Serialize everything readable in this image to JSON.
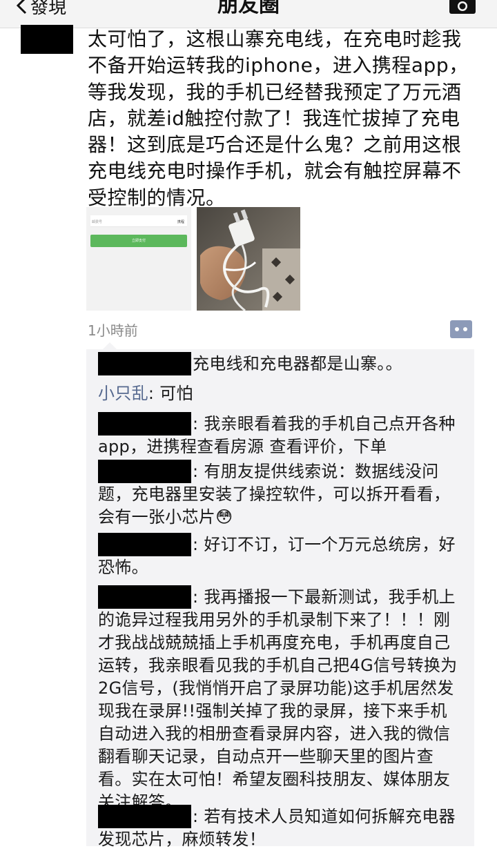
{
  "navbar": {
    "back_label": "發現",
    "title": "朋友圈",
    "back_icon": "chevron-left-icon",
    "camera_icon": "camera-icon"
  },
  "post": {
    "text": "太可怕了，这根山寨充电线，在充电时趁我不备开始运转我的iphone，进入携程app，等我发现，我的手机已经替我预定了万元酒店，就差id触控付款了！我连忙拔掉了充电器！这到底是巧合还是什么鬼？之前用这根充电线充电时操作手机，就会有触控屏幕不受控制的情况。",
    "images": [
      {
        "kind": "screenshot",
        "left_label": "邮费号",
        "right_label": "携程",
        "button_label": "立即支付"
      },
      {
        "kind": "photo-charging-cable"
      }
    ],
    "timestamp": "1小時前"
  },
  "comments": [
    {
      "author": "",
      "text": "充电线和充电器都是山寨。。",
      "redacted": true
    },
    {
      "author": "小只乱",
      "text": ": 可怕",
      "redacted": false
    },
    {
      "author": "",
      "text": ": 我亲眼看着我的手机自己点开各种app，进携程查看房源 查看评价，下单",
      "redacted": true
    },
    {
      "author": "",
      "text": ": 有朋友提供线索说：数据线没问题，充电器里安装了操控软件，可以拆开看看，会有一张小芯片😳",
      "redacted": true
    },
    {
      "author": "",
      "text": ": 好订不订，订一个万元总统房，好恐怖。",
      "redacted": true
    },
    {
      "author": "",
      "text": ": 我再播报一下最新测试，我手机上的诡异过程我用另外的手机录制下来了！！！刚才我战战兢兢插上手机再度充电，手机再度自己运转，我亲眼看见我的手机自己把4G信号转换为2G信号，(我悄悄开启了录屏功能)这手机居然发现我在录屏!!强制关掉了我的录屏，接下来手机自动进入我的相册查看录屏内容，进入我的微信翻看聊天记录，自动点开一些聊天里的图片查看。实在太可怕！希望友圈科技朋友、媒体朋友关注解答。",
      "redacted": true
    },
    {
      "author": "",
      "text": ": 若有技术人员知道如何拆解充电器发现芯片，麻烦转发！",
      "redacted": true
    }
  ],
  "colors": {
    "author_name": "#56698f",
    "comments_bg": "#f3f3f5",
    "navbar_bg": "#f4f4f4",
    "pay_button": "#5cb85c"
  }
}
